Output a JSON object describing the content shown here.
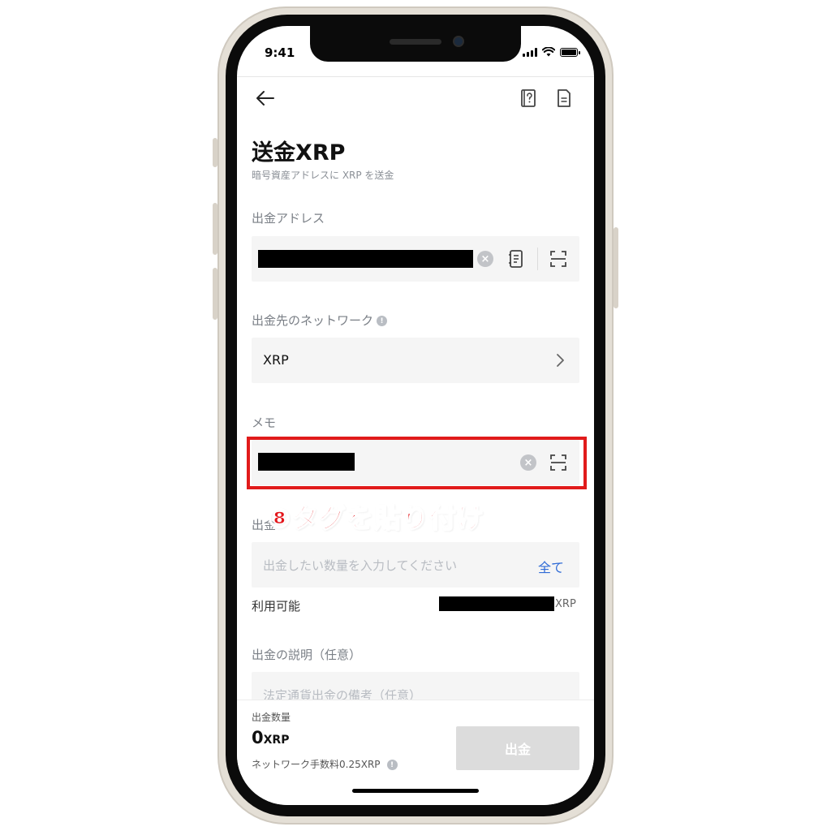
{
  "status": {
    "time": "9:41"
  },
  "header": {
    "back_icon": "arrow-left-icon",
    "help_icon": "help-book-icon",
    "history_icon": "document-icon"
  },
  "page": {
    "title": "送金XRP",
    "subtitle": "暗号資産アドレスに XRP を送金"
  },
  "address": {
    "label": "出金アドレス",
    "value": ""
  },
  "network": {
    "label": "出金先のネットワーク",
    "value": "XRP"
  },
  "memo": {
    "label": "メモ",
    "value": ""
  },
  "amount": {
    "label": "出金",
    "placeholder": "出金したい数量を入力してください",
    "all_label": "全て",
    "available_label": "利用可能",
    "available_unit": "XRP"
  },
  "description": {
    "label": "出金の説明（任意）",
    "placeholder": "法定通貨出金の備考（任意）"
  },
  "footer": {
    "qty_label": "出金数量",
    "qty_value": "0",
    "qty_unit": "XRP",
    "fee_text": "ネットワーク手数料0.25XRP",
    "withdraw_label": "出金"
  },
  "annotation": {
    "text": "⑧タグを貼り付け"
  },
  "colors": {
    "accent_blue": "#2f6bd6",
    "highlight_red": "#e11b1b",
    "disabled_button": "#dcdcdc"
  }
}
